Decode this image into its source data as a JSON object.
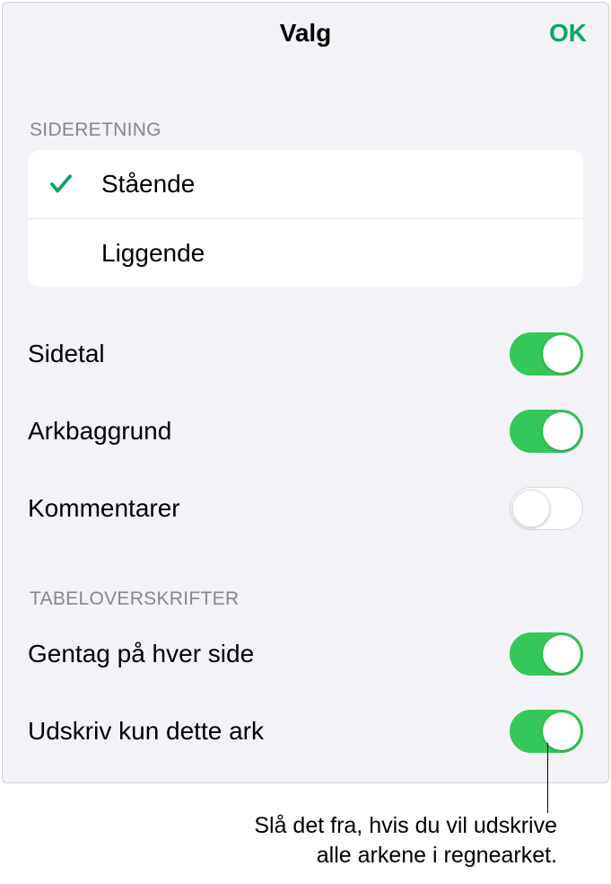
{
  "header": {
    "title": "Valg",
    "ok": "OK"
  },
  "orientation": {
    "header": "SIDERETNING",
    "options": [
      {
        "label": "Stående",
        "selected": true
      },
      {
        "label": "Liggende",
        "selected": false
      }
    ]
  },
  "toggles": [
    {
      "label": "Sidetal",
      "on": true
    },
    {
      "label": "Arkbaggrund",
      "on": true
    },
    {
      "label": "Kommentarer",
      "on": false
    }
  ],
  "tableHeaders": {
    "header": "TABELOVERSKRIFTER",
    "toggles": [
      {
        "label": "Gentag på hver side",
        "on": true
      },
      {
        "label": "Udskriv kun dette ark",
        "on": true
      }
    ]
  },
  "callout": {
    "line1": "Slå det fra, hvis du vil udskrive",
    "line2": "alle arkene i regnearket."
  }
}
